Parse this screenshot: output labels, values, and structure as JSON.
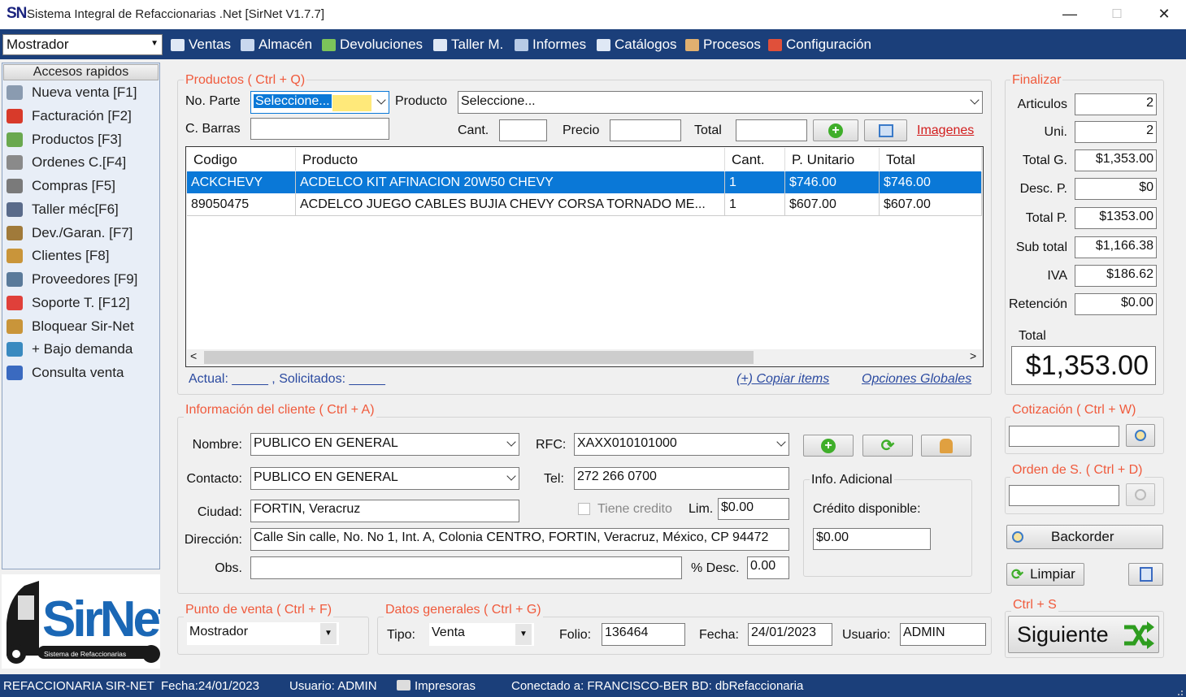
{
  "window": {
    "logo": "SN",
    "title": "Sistema Integral de Refaccionarias .Net [SirNet V1.7.7]",
    "minimize": "—",
    "maximize": "☐",
    "close": "✕"
  },
  "menubar": {
    "mode": "Mostrador",
    "items": [
      {
        "label": "Ventas",
        "icon": "sales-icon"
      },
      {
        "label": "Almacén",
        "icon": "warehouse-icon"
      },
      {
        "label": "Devoluciones",
        "icon": "returns-icon"
      },
      {
        "label": "Taller M.",
        "icon": "workshop-icon"
      },
      {
        "label": "Informes",
        "icon": "reports-icon"
      },
      {
        "label": "Catálogos",
        "icon": "catalogs-icon"
      },
      {
        "label": "Procesos",
        "icon": "processes-icon"
      },
      {
        "label": "Configuración",
        "icon": "settings-icon"
      }
    ]
  },
  "sidebar": {
    "header": "Accesos rapidos",
    "items": [
      {
        "label": "Nueva venta [F1]",
        "color": "#8a9bb0"
      },
      {
        "label": "Facturación [F2]",
        "color": "#d83a2a"
      },
      {
        "label": "Productos [F3]",
        "color": "#6aa84f"
      },
      {
        "label": "Ordenes C.[F4]",
        "color": "#8a8a8a"
      },
      {
        "label": "Compras [F5]",
        "color": "#7a7a7a"
      },
      {
        "label": "Taller méc[F6]",
        "color": "#5a6b8a"
      },
      {
        "label": "Dev./Garan. [F7]",
        "color": "#a07a3a"
      },
      {
        "label": "Clientes [F8]",
        "color": "#c9953a"
      },
      {
        "label": "Proveedores [F9]",
        "color": "#5a7a9a"
      },
      {
        "label": "Soporte T. [F12]",
        "color": "#e0403a"
      },
      {
        "label": "Bloquear Sir-Net",
        "color": "#c9953a"
      },
      {
        "label": "+ Bajo demanda",
        "color": "#3a8ac0"
      },
      {
        "label": "Consulta venta",
        "color": "#3a6ac0"
      }
    ]
  },
  "logo": {
    "brand": "SirNet",
    "tagline": "Sistema de Refaccionarias"
  },
  "productos": {
    "title": "Productos ( Ctrl + Q)",
    "no_parte_label": "No. Parte",
    "no_parte_value": "Seleccione...",
    "producto_label": "Producto",
    "producto_value": "Seleccione...",
    "cbarras_label": "C. Barras",
    "cant_label": "Cant.",
    "precio_label": "Precio",
    "total_label": "Total",
    "imagenes_link": "Imagenes",
    "columns": [
      "Codigo",
      "Producto",
      "Cant.",
      "P. Unitario",
      "Total"
    ],
    "rows": [
      {
        "codigo": "ACKCHEVY",
        "producto": "ACDELCO KIT AFINACION 20W50 CHEVY",
        "cant": "1",
        "unitario": "$746.00",
        "total": "$746.00"
      },
      {
        "codigo": "89050475",
        "producto": "ACDELCO JUEGO CABLES BUJIA CHEVY  CORSA TORNADO ME...",
        "cant": "1",
        "unitario": "$607.00",
        "total": "$607.00"
      }
    ],
    "footer_status": "Actual: _____ , Solicitados: _____",
    "copiar_link": "(+) Copiar items",
    "opciones_link": "Opciones Globales"
  },
  "finalizar": {
    "title": "Finalizar",
    "fields": [
      {
        "label": "Articulos",
        "value": "2"
      },
      {
        "label": "Uni.",
        "value": "2"
      },
      {
        "label": "Total G.",
        "value": "$1,353.00"
      },
      {
        "label": "Desc. P.",
        "value": "$0"
      },
      {
        "label": "Total P.",
        "value": "$1353.00"
      },
      {
        "label": "Sub total",
        "value": "$1,166.38"
      },
      {
        "label": "IVA",
        "value": "$186.62"
      },
      {
        "label": "Retención",
        "value": "$0.00"
      }
    ],
    "total_label": "Total",
    "total_value": "$1,353.00"
  },
  "cliente": {
    "title": "Información del cliente ( Ctrl + A)",
    "nombre_label": "Nombre:",
    "nombre_value": "PUBLICO EN GENERAL",
    "rfc_label": "RFC:",
    "rfc_value": "XAXX010101000",
    "contacto_label": "Contacto:",
    "contacto_value": "PUBLICO EN GENERAL",
    "tel_label": "Tel:",
    "tel_value": "272 266 0700",
    "ciudad_label": "Ciudad:",
    "ciudad_value": "FORTIN, Veracruz",
    "tiene_credito_label": "Tiene credito",
    "lim_label": "Lim.",
    "lim_value": "$0.00",
    "direccion_label": "Dirección:",
    "direccion_value": "Calle Sin calle, No. No 1, Int. A, Colonia CENTRO, FORTIN, Veracruz, México, CP 94472",
    "obs_label": "Obs.",
    "desc_label": "% Desc.",
    "desc_value": "0.00",
    "info_adicional_title": "Info. Adicional",
    "credito_label": "Crédito disponible:",
    "credito_value": "$0.00"
  },
  "cotizacion": {
    "title": "Cotización ( Ctrl + W)"
  },
  "orden": {
    "title": "Orden de S. ( Ctrl + D)"
  },
  "backorder_label": "Backorder",
  "limpiar_label": "Limpiar",
  "siguiente": {
    "title": "Ctrl + S",
    "label": "Siguiente"
  },
  "punto_venta": {
    "title": "Punto de venta ( Ctrl + F)",
    "value": "Mostrador"
  },
  "datos_generales": {
    "title": "Datos generales ( Ctrl + G)",
    "tipo_label": "Tipo:",
    "tipo_value": "Venta",
    "folio_label": "Folio:",
    "folio_value": "136464",
    "fecha_label": "Fecha:",
    "fecha_value": "24/01/2023",
    "usuario_label": "Usuario:",
    "usuario_value": "ADMIN"
  },
  "status": {
    "company": "REFACCIONARIA SIR-NET",
    "fecha": "Fecha:24/01/2023",
    "usuario": "Usuario: ADMIN",
    "impresoras": "Impresoras",
    "conexion": "Conectado a: FRANCISCO-BER BD: dbRefaccionaria"
  }
}
